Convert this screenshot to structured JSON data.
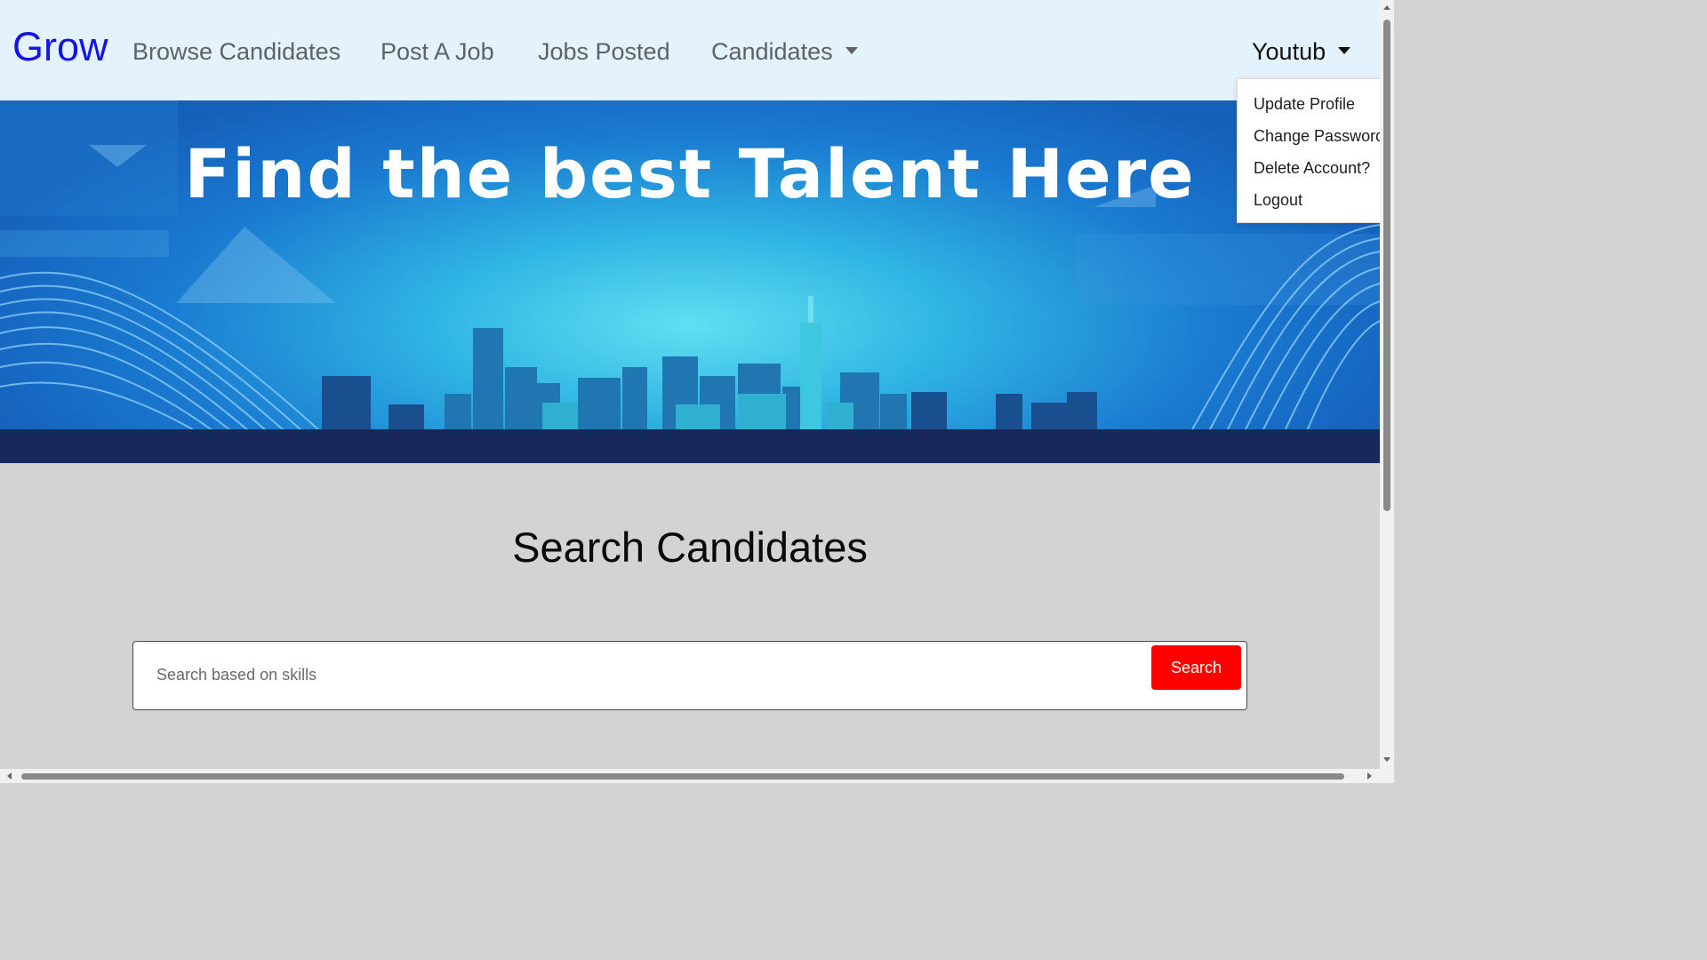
{
  "navbar": {
    "brand": "Grow",
    "links": [
      {
        "label": "Browse Candidates"
      },
      {
        "label": "Post A Job"
      },
      {
        "label": "Jobs Posted"
      },
      {
        "label": "Candidates"
      }
    ],
    "user": "Youtub"
  },
  "user_menu": {
    "items": [
      "Update Profile",
      "Change Password",
      "Delete Account?",
      "Logout"
    ]
  },
  "hero": {
    "title": "Find the best Talent Here"
  },
  "search": {
    "heading": "Search Candidates",
    "placeholder": "Search based on skills",
    "button_label": "Search"
  },
  "colors": {
    "navbar_bg": "#e3f2fd",
    "brand": "#1414e6",
    "search_button": "#ff0000",
    "page_bg": "#d3d3d3"
  },
  "icons": [
    "caret-down-icon",
    "scroll-arrow-icon"
  ]
}
